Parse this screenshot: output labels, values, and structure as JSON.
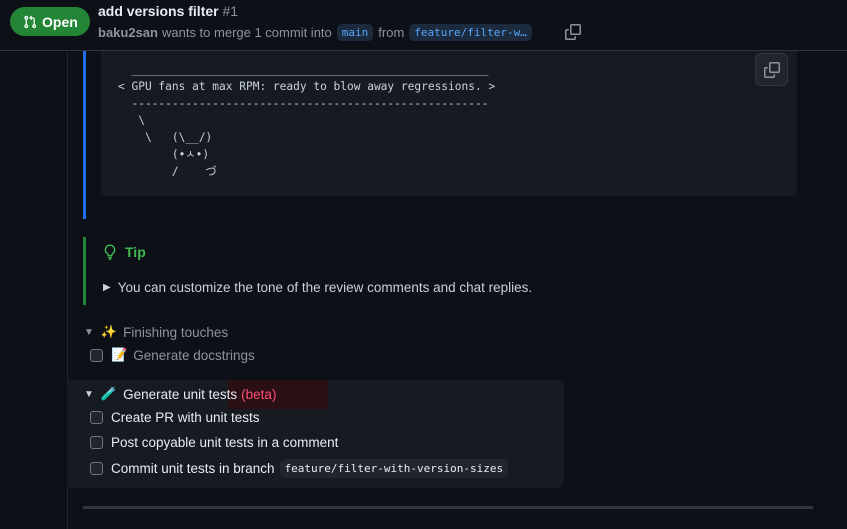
{
  "header": {
    "state": "Open",
    "title": "add versions filter",
    "number": "#1",
    "author": "baku2san",
    "merge_text": "wants to merge 1 commit into",
    "base_branch": "main",
    "from_text": "from",
    "head_branch": "feature/filter-w…"
  },
  "code_block": {
    "lines": [
      "  _____________________________________________________",
      "< GPU fans at max RPM: ready to blow away regressions. >",
      "  -----------------------------------------------------",
      "   \\",
      "    \\   (\\__/)",
      "        (•ㅅ•)",
      "        /    づ"
    ]
  },
  "tip": {
    "label": "Tip",
    "summary": "You can customize the tone of the review comments and chat replies."
  },
  "finishing": {
    "label": "Finishing touches",
    "docstrings": "Generate docstrings"
  },
  "unit_tests": {
    "label": "Generate unit tests",
    "badge": "(beta)",
    "options": [
      "Create PR with unit tests",
      "Post copyable unit tests in a comment",
      "Commit unit tests in branch"
    ],
    "branch": "feature/filter-with-version-sizes"
  },
  "colors": {
    "open_green": "#238636",
    "link_blue": "#58a6ff",
    "tip_green": "#3fb950",
    "beta_red": "#ff4d73"
  }
}
